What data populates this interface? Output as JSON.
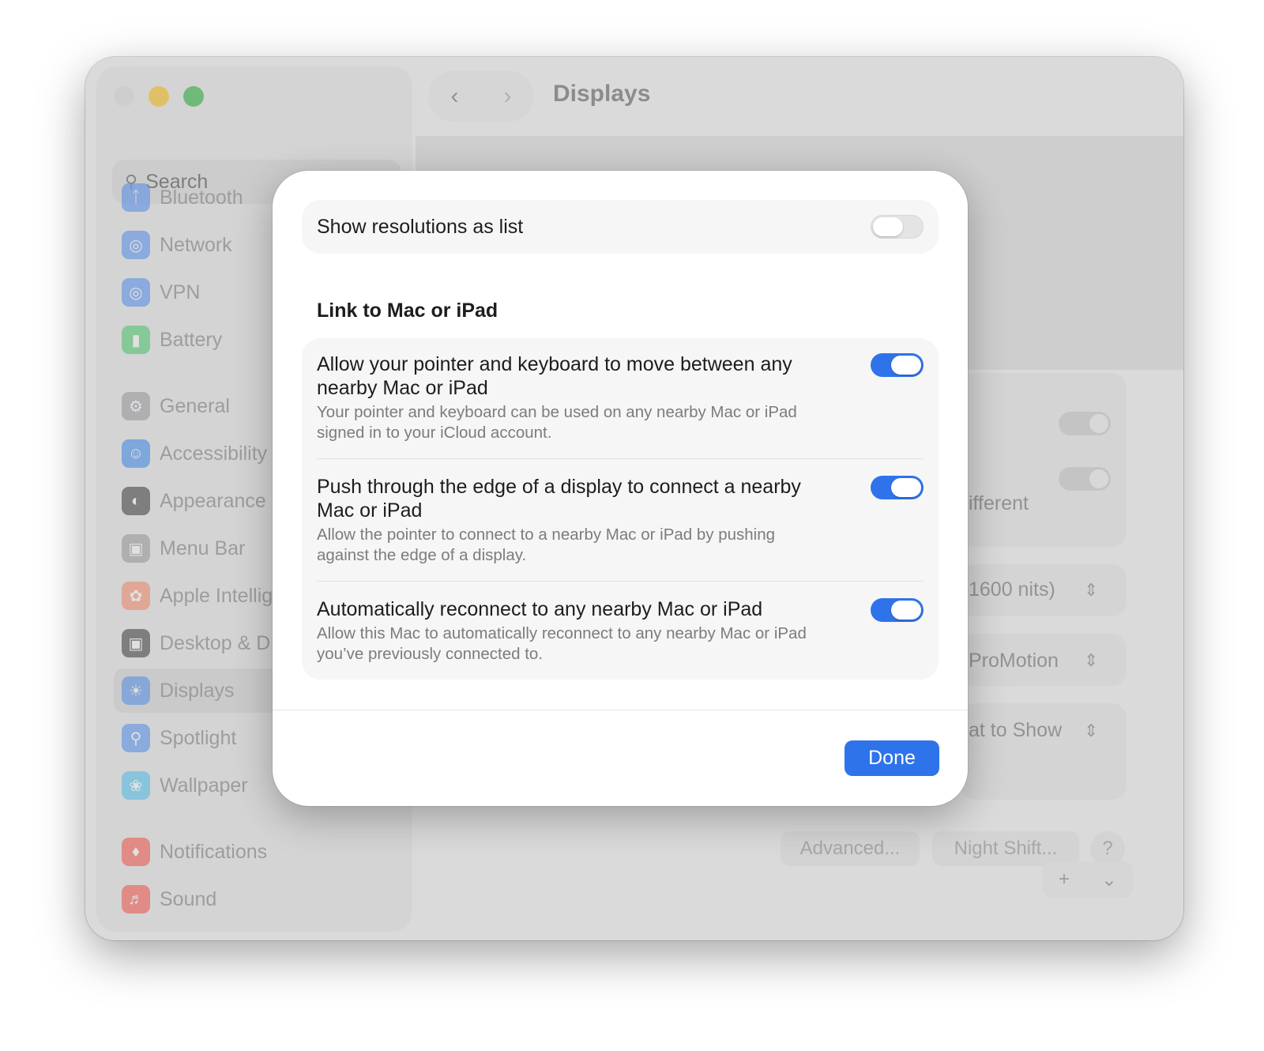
{
  "window": {
    "title": "Displays",
    "nav_back": "‹",
    "nav_forward": "›"
  },
  "sidebar": {
    "search_placeholder": "Search",
    "items": [
      {
        "label": "Bluetooth",
        "icon": "bluetooth-icon",
        "color": "#3b82f6"
      },
      {
        "label": "Network",
        "icon": "globe-icon",
        "color": "#3b82f6"
      },
      {
        "label": "VPN",
        "icon": "globe-icon",
        "color": "#3b82f6"
      },
      {
        "label": "Battery",
        "icon": "battery-icon",
        "color": "#34c759"
      },
      {
        "label": "General",
        "icon": "gear-icon",
        "color": "#8e8e93"
      },
      {
        "label": "Accessibility",
        "icon": "accessibility-icon",
        "color": "#1d7bf5"
      },
      {
        "label": "Appearance",
        "icon": "appearance-icon",
        "color": "#1c1c1e"
      },
      {
        "label": "Menu Bar",
        "icon": "menubar-icon",
        "color": "#8e8e93"
      },
      {
        "label": "Apple Intellig",
        "icon": "apple-intelligence-icon",
        "color": "#ff7b54"
      },
      {
        "label": "Desktop & D",
        "icon": "desktop-icon",
        "color": "#1c1c1e"
      },
      {
        "label": "Displays",
        "icon": "sun-icon",
        "color": "#3b82f6"
      },
      {
        "label": "Spotlight",
        "icon": "magnifier-icon",
        "color": "#3b82f6"
      },
      {
        "label": "Wallpaper",
        "icon": "flower-icon",
        "color": "#38bdf8"
      },
      {
        "label": "Notifications",
        "icon": "bell-icon",
        "color": "#ff3b30"
      },
      {
        "label": "Sound",
        "icon": "speaker-icon",
        "color": "#ff3b30"
      }
    ]
  },
  "background": {
    "partial_text_1": "ifferent",
    "brightness_value": "1600 nits)",
    "refresh_value": "ProMotion",
    "show_value": "at to Show",
    "advanced_label": "Advanced...",
    "night_shift_label": "Night Shift...",
    "help_label": "?",
    "add_label": "+",
    "chevron_label": "⌄"
  },
  "sheet": {
    "show_resolutions": {
      "label": "Show resolutions as list",
      "on": false
    },
    "section_title": "Link to Mac or iPad",
    "rows": [
      {
        "title_line1": "Allow your pointer and keyboard to move between any",
        "title_line2": "nearby Mac or iPad",
        "desc_line1": "Your pointer and keyboard can be used on any nearby Mac or iPad",
        "desc_line2": "signed in to your iCloud account.",
        "on": true
      },
      {
        "title_line1": "Push through the edge of a display to connect a nearby",
        "title_line2": "Mac or iPad",
        "desc_line1": "Allow the pointer to connect to a nearby Mac or iPad by pushing",
        "desc_line2": "against the edge of a display.",
        "on": true
      },
      {
        "title_line1": "Automatically reconnect to any nearby Mac or iPad",
        "desc_line1": "Allow this Mac to automatically reconnect to any nearby Mac or iPad",
        "desc_line2": "you’ve previously connected to.",
        "on": true
      }
    ],
    "done_label": "Done"
  },
  "colors": {
    "accent": "#2e73ea",
    "traffic_close": "#d9d9d9",
    "traffic_minimize": "#f5c233",
    "traffic_maximize": "#3fb84f"
  }
}
